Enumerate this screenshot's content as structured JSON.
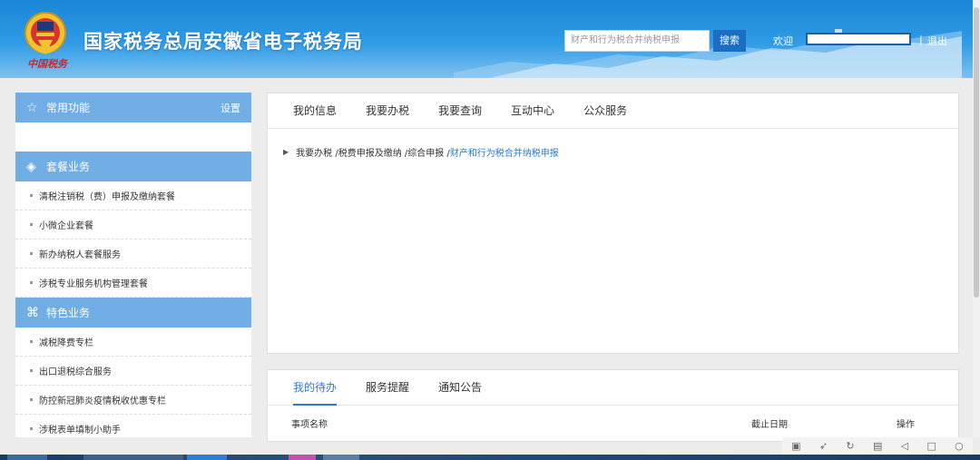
{
  "header": {
    "brand_script": "中国税务",
    "title": "国家税务总局安徽省电子税务局",
    "search_placeholder": "财产和行为税合并纳税申报",
    "search_button": "搜索",
    "welcome": "欢迎",
    "separator": "|",
    "logout": "退出"
  },
  "sidebar": {
    "common": {
      "label": "常用功能",
      "settings": "设置"
    },
    "package": {
      "label": "套餐业务",
      "items": [
        "清税注销税（费）申报及缴纳套餐",
        "小微企业套餐",
        "新办纳税人套餐服务",
        "涉税专业服务机构管理套餐"
      ]
    },
    "special": {
      "label": "特色业务",
      "items": [
        "减税降费专栏",
        "出口退税综合服务",
        "防控新冠肺炎疫情税收优惠专栏",
        "涉税表单填制小助手"
      ]
    }
  },
  "main_tabs": [
    "我的信息",
    "我要办税",
    "我要查询",
    "互动中心",
    "公众服务"
  ],
  "breadcrumb": {
    "path": "我要办税 /税费申报及缴纳 /综合申报 /",
    "current": "财产和行为税合并纳税申报"
  },
  "todo": {
    "tabs": [
      "我的待办",
      "服务提醒",
      "通知公告"
    ],
    "columns": [
      "事项名称",
      "截止日期",
      "操作"
    ]
  },
  "colors": {
    "header": "#2f9be6",
    "sidebar_head": "#72aee6",
    "accent": "#2b7bd4"
  }
}
